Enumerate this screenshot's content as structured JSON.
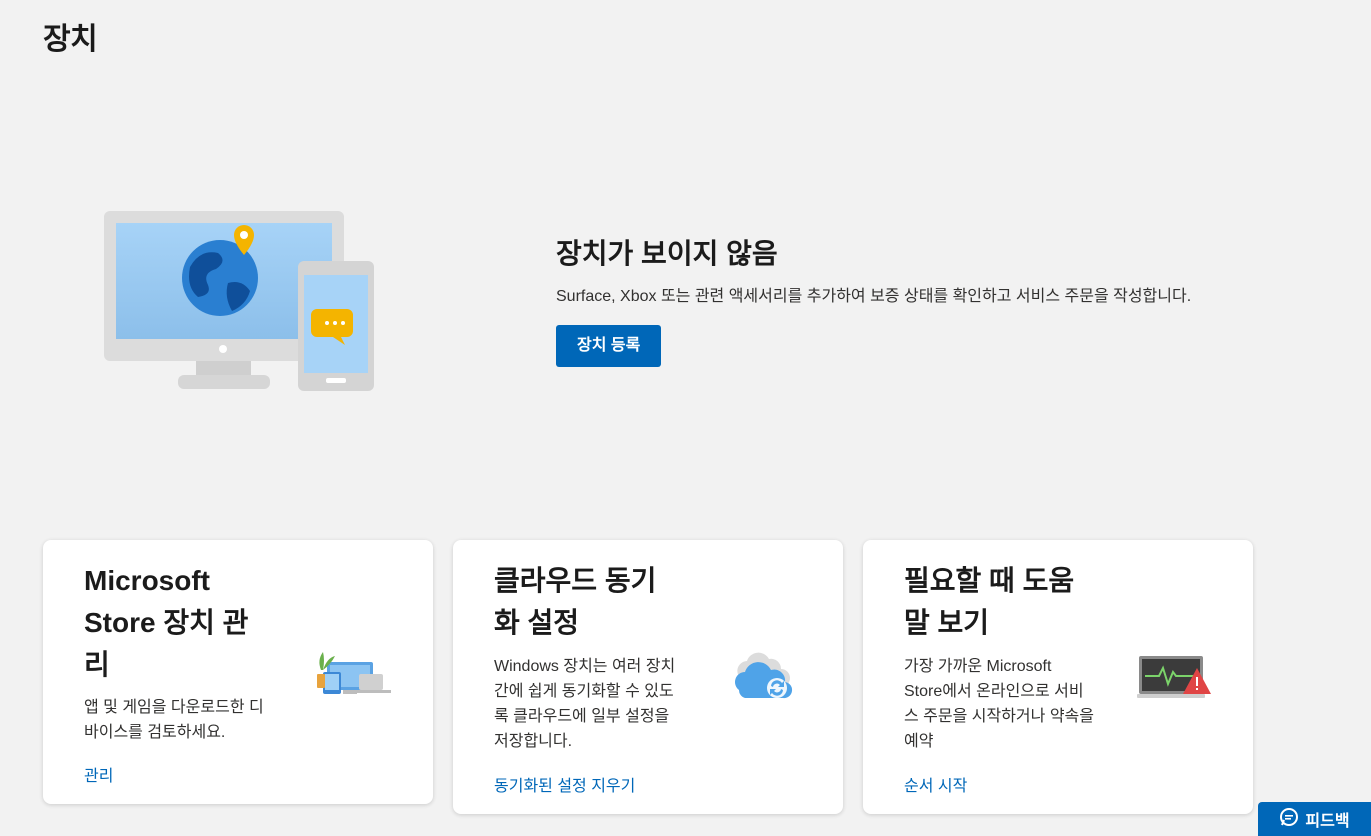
{
  "page": {
    "title": "장치"
  },
  "hero": {
    "heading": "장치가 보이지 않음",
    "description": "Surface, Xbox 또는 관련 액세서리를 추가하여 보증 상태를 확인하고 서비스 주문을 작성합니다.",
    "button_label": "장치 등록",
    "illustration": "monitor-phone-illustration"
  },
  "cards": [
    {
      "title": "Microsoft Store 장치 관리",
      "description": "앱 및 게임을 다운로드한 디바이스를 검토하세요.",
      "link": "관리",
      "icon": "devices-icon"
    },
    {
      "title": "클라우드 동기화 설정",
      "description": "Windows 장치는 여러 장치 간에 쉽게 동기화할 수 있도록 클라우드에 일부 설정을 저장합니다.",
      "link": "동기화된 설정 지우기",
      "icon": "cloud-sync-icon"
    },
    {
      "title": "필요할 때 도움말 보기",
      "description": "가장 가까운 Microsoft Store에서 온라인으로 서비스 주문을 시작하거나 약속을 예약",
      "link": "순서 시작",
      "icon": "laptop-warning-icon"
    }
  ],
  "feedback": {
    "label": "피드백",
    "icon": "chat-icon"
  },
  "colors": {
    "accent": "#0067b8",
    "background": "#f2f2f2",
    "card": "#ffffff"
  }
}
